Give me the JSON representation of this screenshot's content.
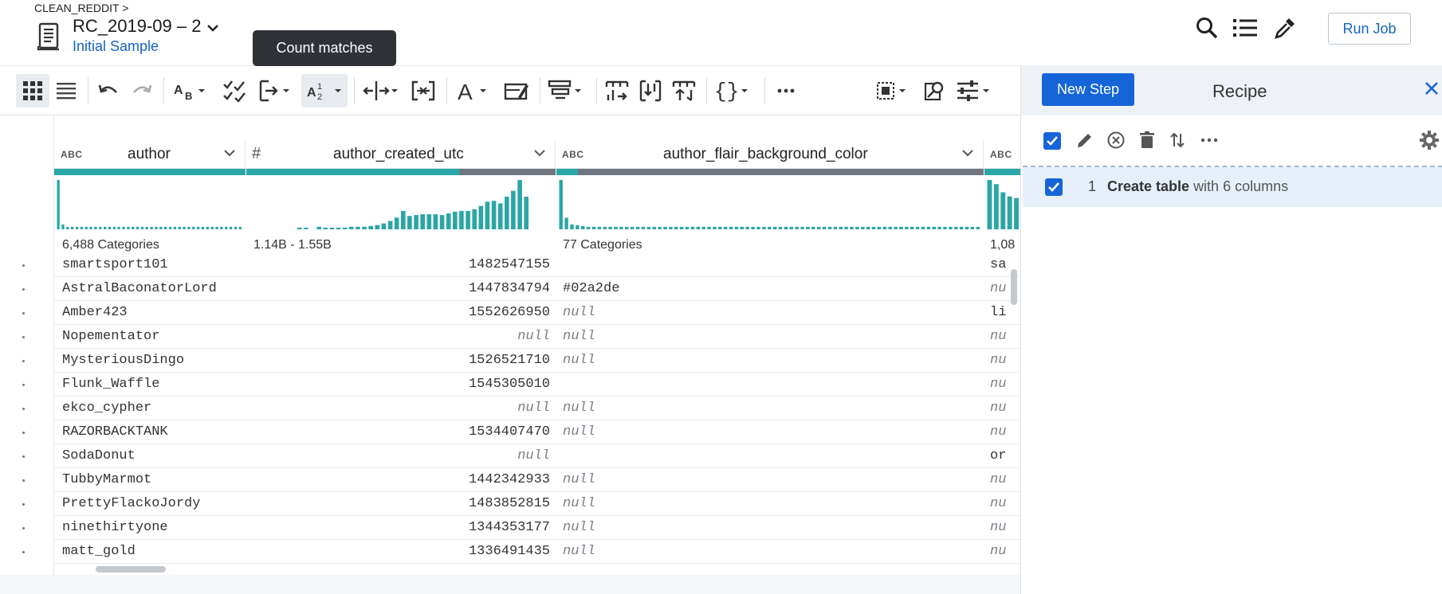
{
  "header": {
    "breadcrumb": "CLEAN_REDDIT >",
    "title": "RC_2019-09 – 2",
    "subtitle": "Initial Sample",
    "run_job_label": "Run Job",
    "icons": [
      "search-icon",
      "list-icon",
      "eyedropper-icon"
    ]
  },
  "tooltip": {
    "text": "Count matches"
  },
  "toolbar": {
    "items": [
      "grid-view-icon",
      "list-view-icon",
      "undo-icon",
      "redo-icon",
      "split-format-icon",
      "check-list-icon",
      "merge-icon",
      "count-matches-icon",
      "split-column-icon",
      "extract-icon",
      "text-format-icon",
      "rename-icon",
      "filter-rows-icon",
      "pivot-icon",
      "unpivot-icon",
      "restructure-icon",
      "nested-icon",
      "more-icon",
      "select-icon",
      "search-transform-icon",
      "settings-icon"
    ]
  },
  "grid": {
    "columns": [
      {
        "type": "ABC",
        "name": "author",
        "summary": "6,488 Categories",
        "quality": {
          "valid": 1.0,
          "mismatched": 0.0
        },
        "histogram": [
          60,
          6,
          3,
          3,
          3,
          3,
          3,
          3,
          3,
          3,
          3,
          3,
          3,
          3,
          3,
          3,
          3,
          3,
          3,
          3,
          3,
          3,
          3,
          3,
          3,
          3,
          3,
          3,
          3,
          3,
          3,
          3,
          3,
          3,
          3,
          3,
          3,
          3,
          3,
          3
        ]
      },
      {
        "type": "#",
        "name": "author_created_utc",
        "summary": "1.14B - 1.55B",
        "quality": {
          "valid": 0.69,
          "mismatched": 0.31
        },
        "histogram": [
          0,
          0,
          0,
          0,
          2,
          2,
          0,
          3,
          2,
          2,
          2,
          2,
          3,
          3,
          3,
          4,
          5,
          7,
          10,
          14,
          22,
          16,
          17,
          18,
          18,
          18,
          17,
          19,
          21,
          22,
          22,
          24,
          28,
          33,
          34,
          31,
          39,
          46,
          59,
          39
        ]
      },
      {
        "type": "ABC",
        "name": "author_flair_background_color",
        "summary": "77 Categories",
        "quality": {
          "valid": 0.05,
          "mismatched": 0.95
        },
        "histogram": [
          60,
          14,
          6,
          5,
          4,
          3,
          3,
          3,
          3,
          3,
          3,
          3,
          3,
          3,
          3,
          3,
          3,
          3,
          3,
          3,
          3,
          3,
          3,
          3,
          3,
          3,
          3,
          3,
          3,
          3,
          3,
          3,
          3,
          3,
          3,
          3,
          3,
          3,
          3,
          3,
          3,
          3,
          3,
          3,
          3,
          3,
          3,
          3,
          3,
          3,
          3,
          3,
          3,
          3,
          3,
          3,
          3,
          3,
          3,
          3,
          3,
          3,
          3,
          3,
          3,
          3,
          3,
          3,
          3,
          3,
          3,
          3,
          3,
          3,
          3,
          3,
          3
        ]
      },
      {
        "type": "ABC",
        "name": "",
        "summary": "1,08",
        "quality": {
          "valid": 1.0,
          "mismatched": 0.0
        },
        "histogram": [
          60,
          55,
          45,
          40,
          38
        ]
      }
    ],
    "rows": [
      [
        "smartsport101",
        "1482547155",
        "",
        "sa"
      ],
      [
        "AstralBaconatorLord",
        "1447834794",
        "#02a2de",
        "nu"
      ],
      [
        "Amber423",
        "1552626950",
        "null",
        "li"
      ],
      [
        "Nopementator",
        "null",
        "null",
        "nu"
      ],
      [
        "MysteriousDingo",
        "1526521710",
        "null",
        "nu"
      ],
      [
        "Flunk_Waffle",
        "1545305010",
        "",
        "nu"
      ],
      [
        "ekco_cypher",
        "null",
        "null",
        "nu"
      ],
      [
        "RAZORBACKTANK",
        "1534407470",
        "null",
        "nu"
      ],
      [
        "SodaDonut",
        "null",
        "",
        "or"
      ],
      [
        "TubbyMarmot",
        "1442342933",
        "null",
        "nu"
      ],
      [
        "PrettyFlackoJordy",
        "1483852815",
        "null",
        "nu"
      ],
      [
        "ninethirtyone",
        "1344353177",
        "null",
        "nu"
      ],
      [
        "matt_gold",
        "1336491435",
        "null",
        "nu"
      ]
    ],
    "null_marker": "null"
  },
  "recipe": {
    "new_step_label": "New Step",
    "title": "Recipe",
    "steps": [
      {
        "number": "1",
        "action": "Create table",
        "detail": "with 6 columns"
      }
    ]
  },
  "colors": {
    "accent": "#1565d8",
    "valid_bar": "#2ba6a6",
    "mismatch_bar": "#6f767e",
    "histogram": "#2ba6a6"
  }
}
